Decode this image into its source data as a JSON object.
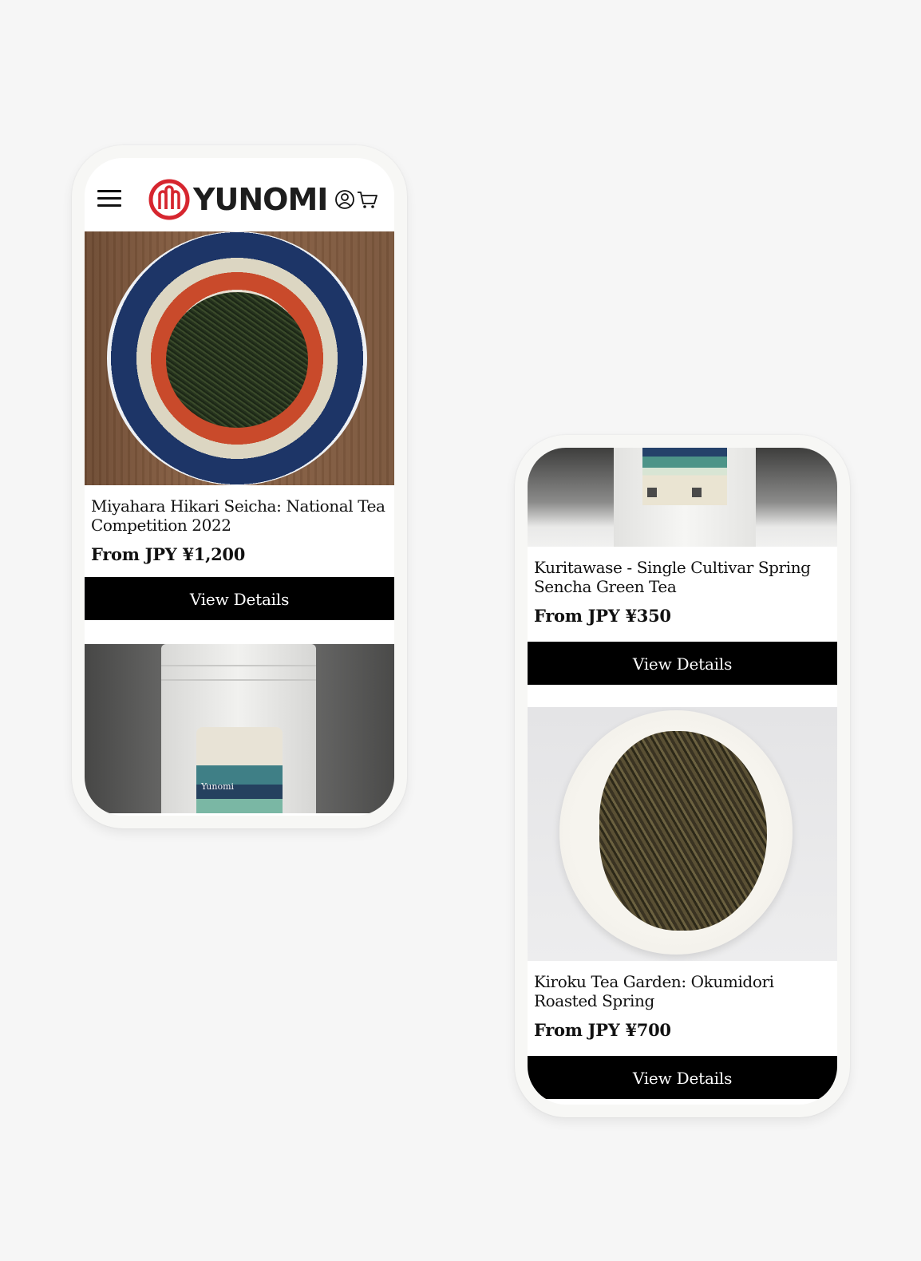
{
  "header": {
    "brand": "YUNOMI",
    "icons": {
      "menu": "menu-icon",
      "account": "account-icon",
      "cart": "cart-icon"
    }
  },
  "colors": {
    "brand_red": "#d6262f",
    "button_bg": "#000000",
    "button_text": "#ffffff"
  },
  "phone1": {
    "products": [
      {
        "title": "Miyahara Hikari Seicha: National Tea Competition 2022",
        "price": "From JPY ¥1,200",
        "button": "View Details"
      }
    ],
    "next_image_label": "Yunomi"
  },
  "phone2": {
    "products": [
      {
        "title": "Kuritawase - Single Cultivar Spring Sencha Green Tea",
        "price": "From JPY ¥350",
        "button": "View Details"
      },
      {
        "title": "Kiroku Tea Garden: Okumidori Roasted Spring",
        "price": "From JPY ¥700",
        "button": "View Details"
      }
    ]
  }
}
